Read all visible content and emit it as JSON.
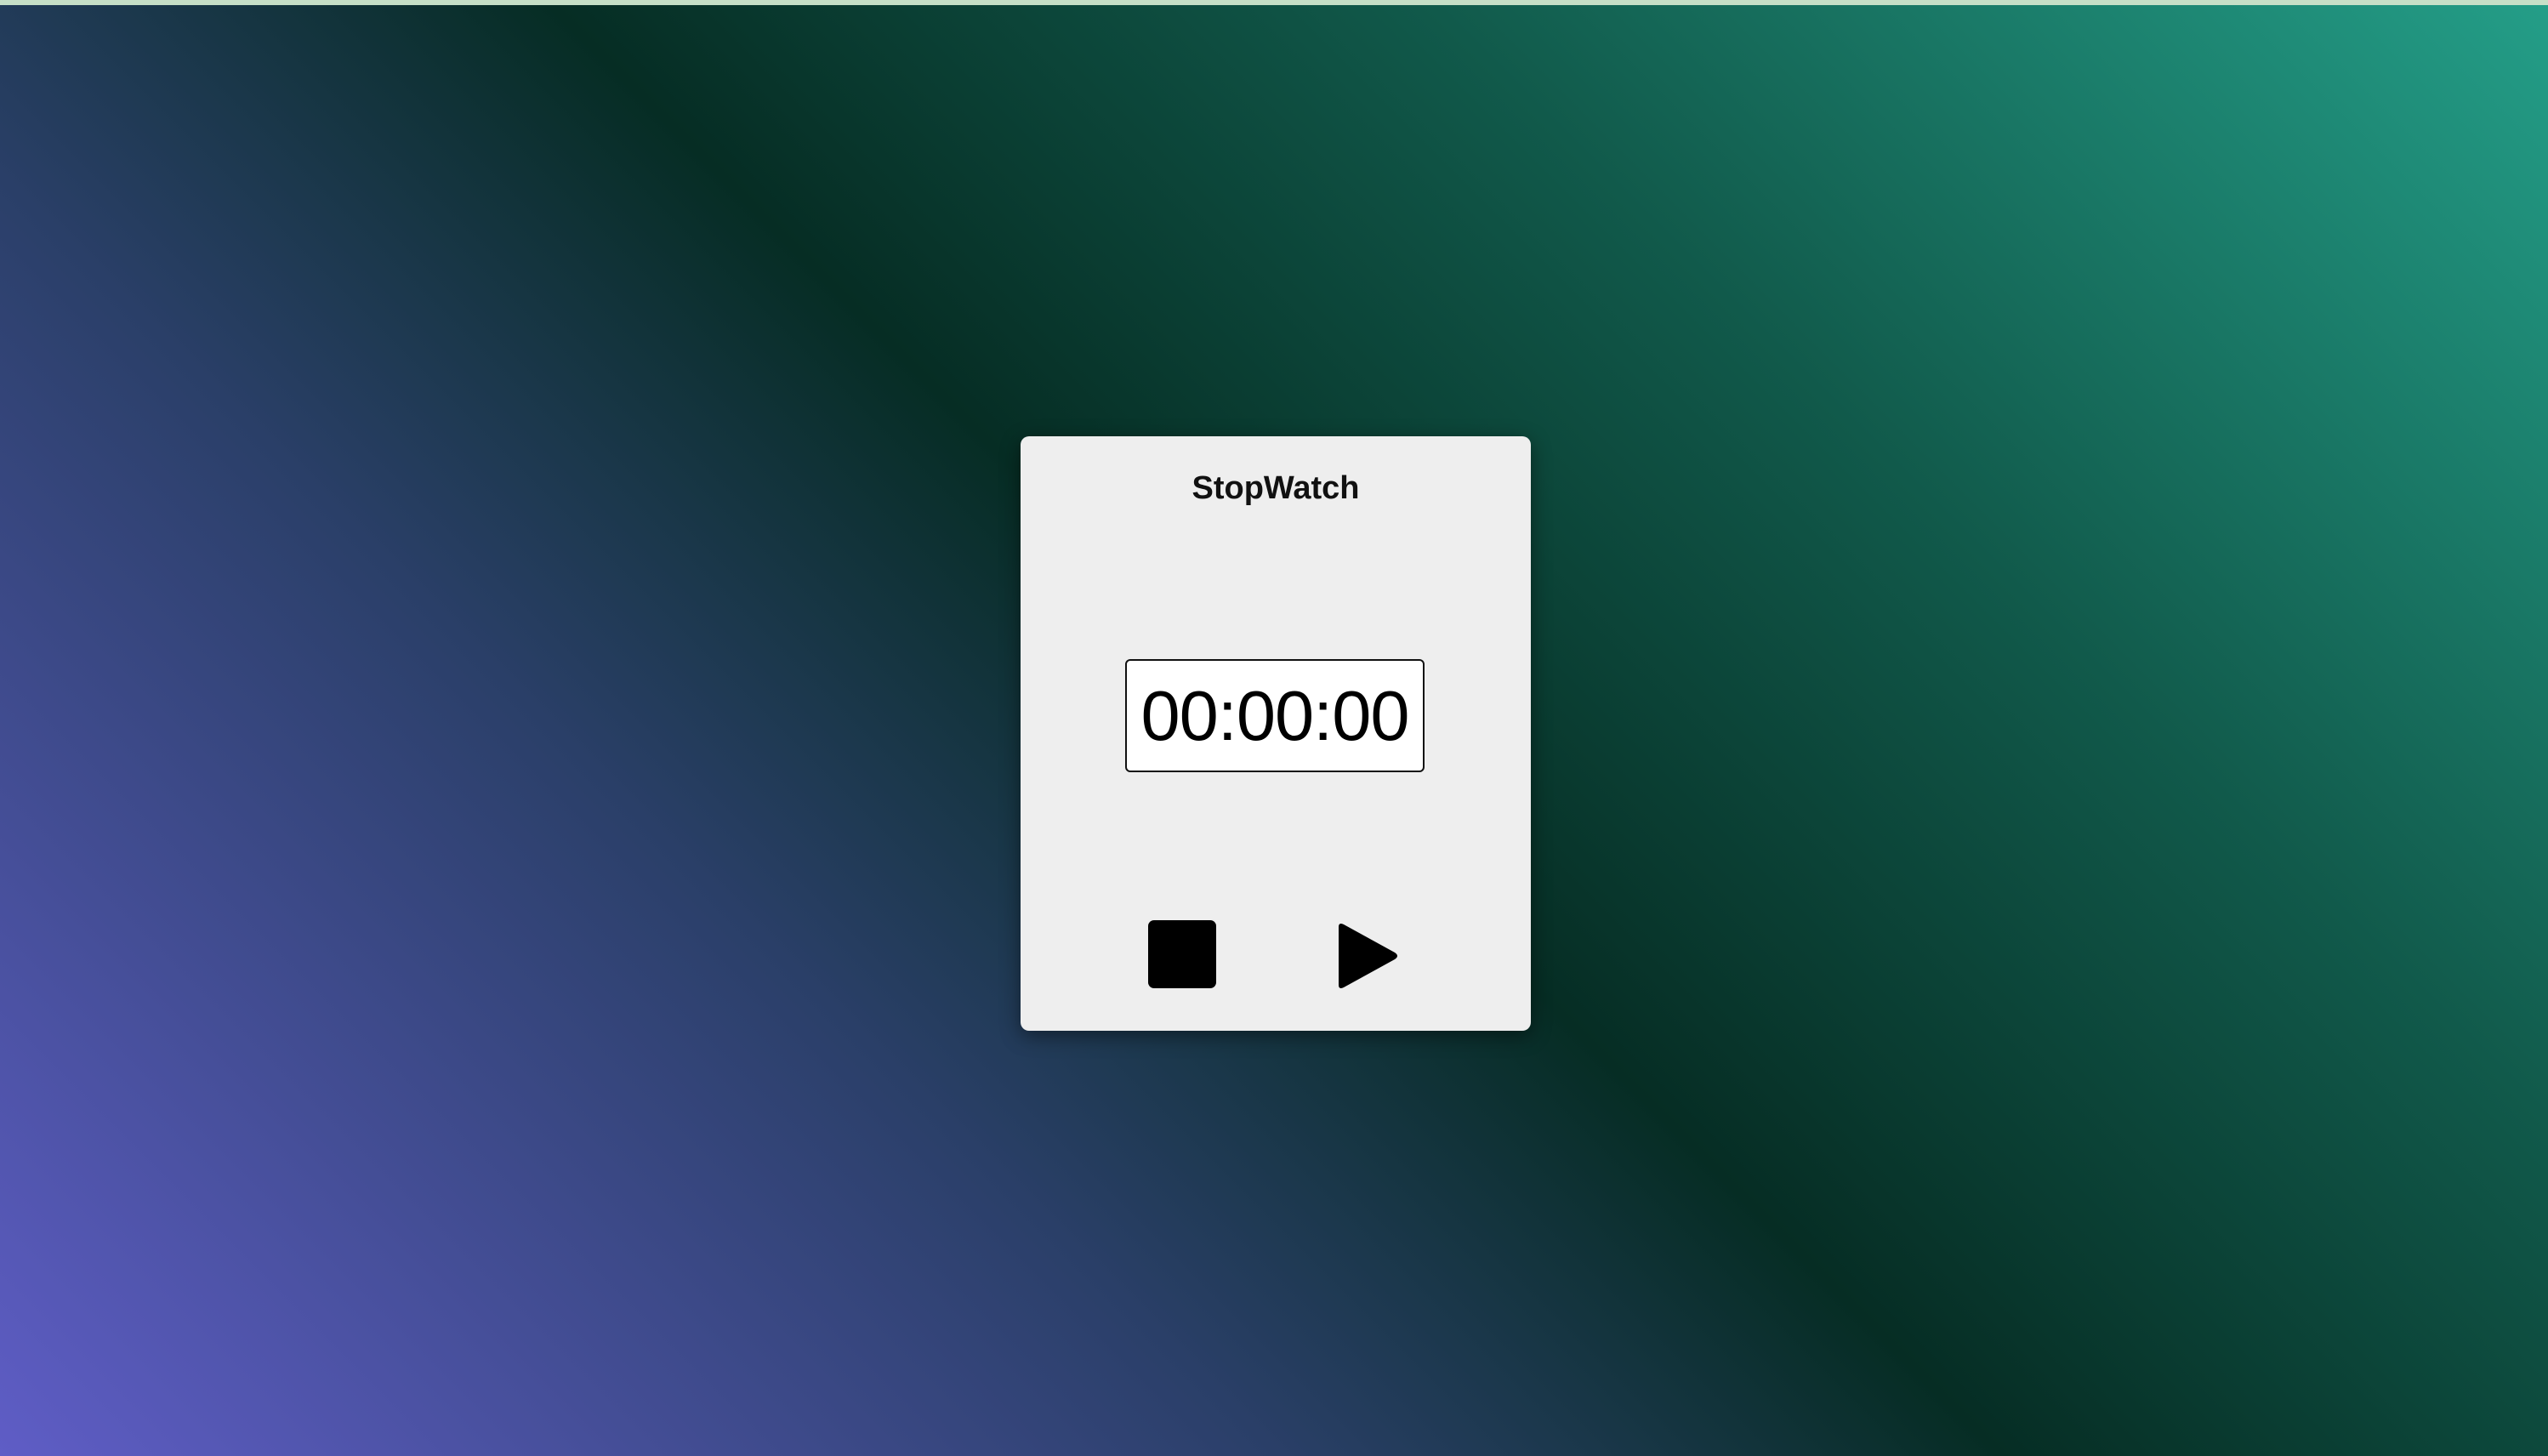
{
  "app": {
    "title": "StopWatch"
  },
  "timer": {
    "display": "00:00:00"
  },
  "controls": {
    "stop": {
      "icon": "stop-icon"
    },
    "play": {
      "icon": "play-icon"
    }
  },
  "colors": {
    "card": "#eeeeee",
    "text": "#000000",
    "gradient_start": "#5f5dc6",
    "gradient_mid": "#062d24",
    "gradient_end": "#249e88"
  }
}
